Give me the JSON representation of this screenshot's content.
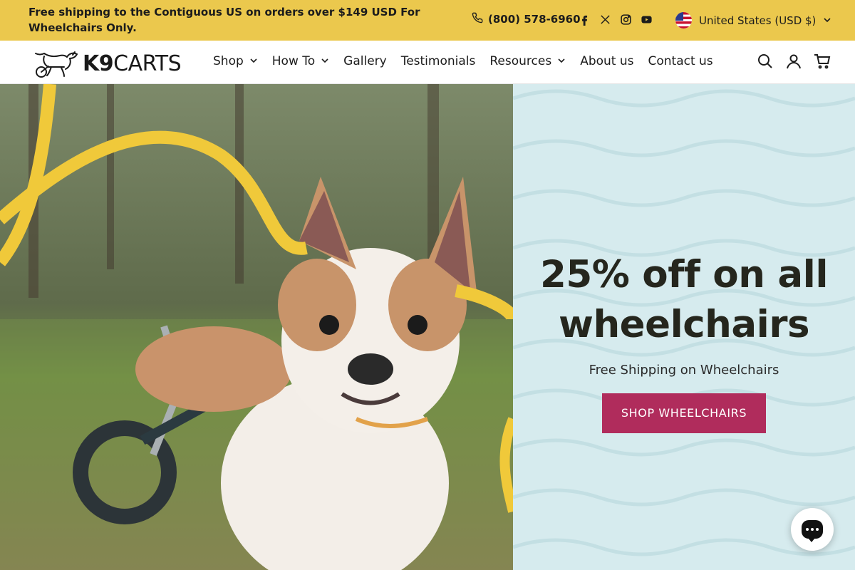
{
  "announcement": {
    "promo_text": "Free shipping to the Contiguous US on orders over $149 USD For Wheelchairs Only.",
    "phone": "(800) 578-6960",
    "socials": [
      "facebook-icon",
      "x-icon",
      "instagram-icon",
      "youtube-icon"
    ],
    "currency": "United States (USD $)"
  },
  "header": {
    "logo_text_bold": "K9",
    "logo_text_rest": "CARTS",
    "nav": [
      {
        "label": "Shop",
        "dropdown": true
      },
      {
        "label": "How To",
        "dropdown": true
      },
      {
        "label": "Gallery",
        "dropdown": false
      },
      {
        "label": "Testimonials",
        "dropdown": false
      },
      {
        "label": "Resources",
        "dropdown": true
      },
      {
        "label": "About us",
        "dropdown": false
      },
      {
        "label": "Contact us",
        "dropdown": false
      }
    ],
    "tools": [
      "search-icon",
      "account-icon",
      "cart-icon"
    ]
  },
  "hero": {
    "title_line1": "25% off on all",
    "title_line2": "wheelchairs",
    "subtitle": "Free Shipping on Wheelchairs",
    "cta_label": "SHOP WHEELCHAIRS"
  },
  "colors": {
    "announcement_bg": "#ebc84d",
    "hero_panel_bg": "#d6ebee",
    "cta_bg": "#b02c5c",
    "ribbon": "#f0c93a"
  }
}
